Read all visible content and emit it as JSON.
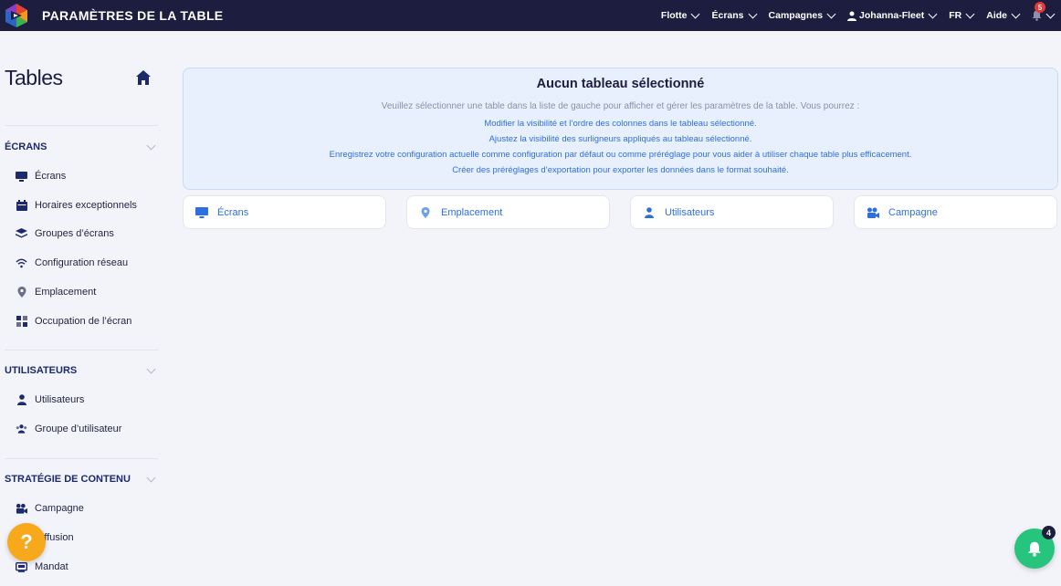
{
  "header": {
    "app_title": "PARAMÈTRES DE LA TABLE",
    "nav": [
      {
        "label": "Flotte"
      },
      {
        "label": "Écrans"
      },
      {
        "label": "Campagnes"
      },
      {
        "label": "Johanna-Fleet"
      },
      {
        "label": "FR"
      },
      {
        "label": "Aide"
      }
    ],
    "bell_count": "5"
  },
  "sidebar": {
    "title": "Tables",
    "sections": [
      {
        "label": "ÉCRANS",
        "items": [
          {
            "label": "Écrans",
            "icon": "monitor-icon"
          },
          {
            "label": "Horaires exceptionnels",
            "icon": "calendar-icon"
          },
          {
            "label": "Groupes d’écrans",
            "icon": "layers-icon"
          },
          {
            "label": "Configuration réseau",
            "icon": "wifi-icon"
          },
          {
            "label": "Emplacement",
            "icon": "location-pin-icon"
          },
          {
            "label": "Occupation de l’écran",
            "icon": "grid-icon"
          }
        ]
      },
      {
        "label": "UTILISATEURS",
        "items": [
          {
            "label": "Utilisateurs",
            "icon": "user-icon"
          },
          {
            "label": "Groupe d’utilisateur",
            "icon": "users-icon"
          }
        ]
      },
      {
        "label": "STRATÉGIE DE CONTENU",
        "items": [
          {
            "label": "Campagne",
            "icon": "campaign-icon"
          },
          {
            "label": "Diffusion",
            "icon": "broadcast-icon"
          },
          {
            "label": "Mandat",
            "icon": "contract-icon"
          }
        ]
      }
    ]
  },
  "main": {
    "info_title": "Aucun tableau sélectionné",
    "info_desc": "Veuillez sélectionner une table dans la liste de gauche pour afficher et gérer les paramètres de la table. Vous pourrez :",
    "info_lines": [
      "Modifier la visibilité et l’ordre des colonnes dans le tableau sélectionné.",
      "Ajustez la visibilité des surligneurs appliqués au tableau sélectionné.",
      "Enregistrez votre configuration actuelle comme configuration par défaut ou comme préréglage pour vous aider à utiliser chaque table plus efficacement.",
      "Créer des préréglages d’exportation pour exporter les données dans le format souhaité."
    ],
    "cards": [
      {
        "label": "Écrans",
        "icon": "monitor-icon"
      },
      {
        "label": "Emplacement",
        "icon": "location-pin-icon"
      },
      {
        "label": "Utilisateurs",
        "icon": "user-icon"
      },
      {
        "label": "Campagne",
        "icon": "campaign-icon"
      }
    ]
  },
  "floating": {
    "help_label": "?",
    "notif_count": "4"
  },
  "colors": {
    "topbar": "#1c1d3f",
    "accent_blue": "#2e6fe0",
    "help_orange": "#f7a81b",
    "notif_green": "#27c47e"
  }
}
